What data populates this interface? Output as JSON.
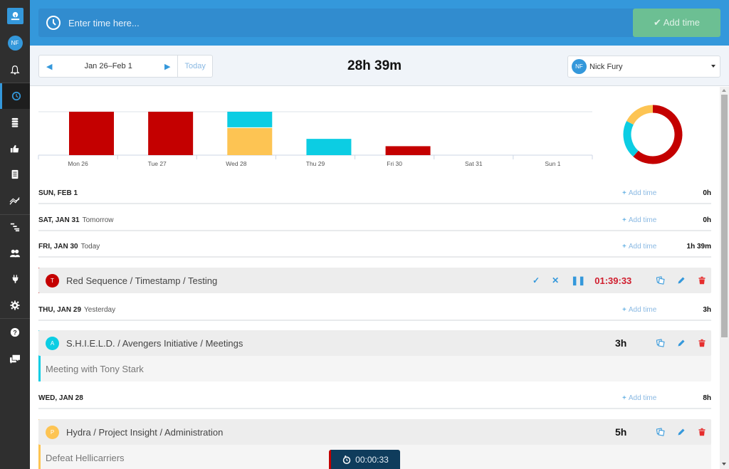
{
  "sidebar": {
    "user_initials": "NF",
    "items": [
      {
        "name": "notifications",
        "icon": "bell-icon"
      },
      {
        "name": "timesheet",
        "icon": "clock-icon",
        "active": true
      },
      {
        "name": "projects",
        "icon": "database-icon"
      },
      {
        "name": "approvals",
        "icon": "thumbs-up-icon"
      },
      {
        "name": "invoices",
        "icon": "document-icon"
      },
      {
        "name": "reports",
        "icon": "chart-line-icon"
      },
      {
        "name": "schedule",
        "icon": "gantt-icon"
      },
      {
        "name": "team",
        "icon": "users-icon"
      },
      {
        "name": "integrations",
        "icon": "plug-icon"
      },
      {
        "name": "settings",
        "icon": "gear-icon"
      },
      {
        "name": "help",
        "icon": "question-icon"
      },
      {
        "name": "feedback",
        "icon": "chat-icon"
      }
    ]
  },
  "topbar": {
    "time_input_placeholder": "Enter time here...",
    "add_time_label": "✔ Add time"
  },
  "toolbar": {
    "date_range": "Jan 26–Feb 1",
    "today_label": "Today",
    "total": "28h 39m",
    "user": {
      "initials": "NF",
      "name": "Nick Fury"
    }
  },
  "colors": {
    "red": "#c40000",
    "cyan": "#0ccde3",
    "yellow": "#fdc453",
    "accent": "#3498db",
    "green": "#6cbf93",
    "timer_red": "#d01e2e"
  },
  "chart_data": [
    {
      "type": "bar",
      "stacked": true,
      "title": "",
      "xlabel": "",
      "ylabel": "",
      "categories": [
        "Mon 26",
        "Tue 27",
        "Wed 28",
        "Thu 29",
        "Fri 30",
        "Sat 31",
        "Sun 1"
      ],
      "series": [
        {
          "name": "Red Sequence",
          "color": "#c40000",
          "values": [
            8,
            8,
            0,
            0,
            1.65,
            0,
            0
          ]
        },
        {
          "name": "Hydra",
          "color": "#fdc453",
          "values": [
            0,
            0,
            5,
            0,
            0,
            0,
            0
          ]
        },
        {
          "name": "S.H.I.E.L.D.",
          "color": "#0ccde3",
          "values": [
            0,
            0,
            3,
            3,
            0,
            0,
            0
          ]
        }
      ],
      "ylim": [
        0,
        8
      ],
      "grid": true
    },
    {
      "type": "pie",
      "donut": true,
      "labels": [
        "Red Sequence",
        "S.H.I.E.L.D.",
        "Hydra"
      ],
      "values": [
        17.65,
        6,
        5
      ],
      "colors": [
        "#c40000",
        "#0ccde3",
        "#fdc453"
      ]
    }
  ],
  "days": [
    {
      "label": "SUN, FEB 1",
      "relative": "",
      "add_label": "Add time",
      "total": "0h"
    },
    {
      "label": "SAT, JAN 31",
      "relative": "Tomorrow",
      "add_label": "Add time",
      "total": "0h"
    },
    {
      "label": "FRI, JAN 30",
      "relative": "Today",
      "add_label": "Add time",
      "total": "1h 39m"
    },
    {
      "label": "THU, JAN 29",
      "relative": "Yesterday",
      "add_label": "Add time",
      "total": "3h"
    },
    {
      "label": "WED, JAN 28",
      "relative": "",
      "add_label": "Add time",
      "total": "8h"
    }
  ],
  "entries": [
    {
      "badge": "T",
      "color": "#c40000",
      "title": "Red Sequence / Timestamp / Testing",
      "running": true,
      "timer": "01:39:33",
      "note": ""
    },
    {
      "badge": "A",
      "color": "#0ccde3",
      "title": "S.H.I.E.L.D. / Avengers Initiative / Meetings",
      "duration": "3h",
      "note": "Meeting with Tony Stark"
    },
    {
      "badge": "P",
      "color": "#fdc453",
      "title": "Hydra / Project Insight / Administration",
      "duration": "5h",
      "note": "Defeat Hellicarriers"
    }
  ],
  "float_timer": {
    "value": "00:00:33"
  }
}
